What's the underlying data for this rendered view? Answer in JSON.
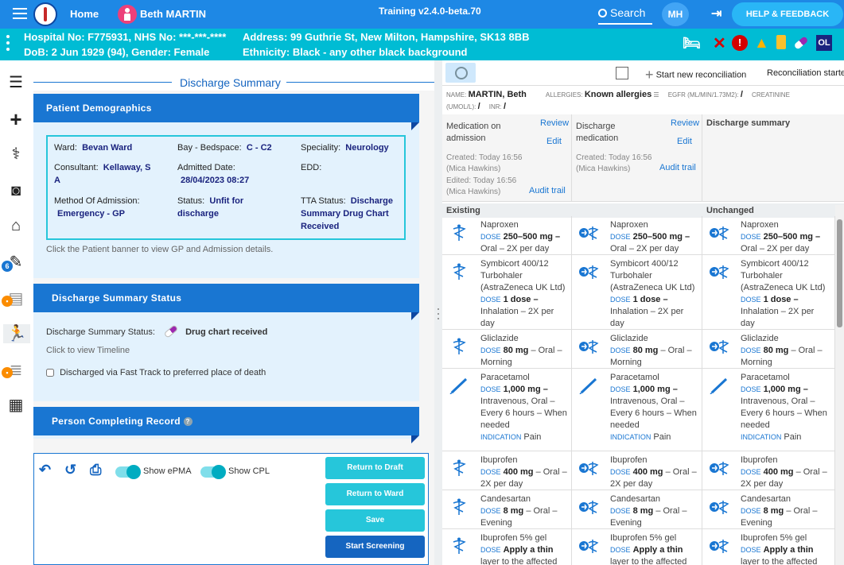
{
  "app": {
    "home_label": "Home",
    "patient_name": "Beth MARTIN",
    "version": "Training v2.4.0-beta.70",
    "search_label": "Search",
    "user_initials": "MH",
    "help_label": "HELP & FEEDBACK"
  },
  "banner": {
    "line1_left": "Hospital No: F775931, NHS No: ***-***-****",
    "line2_left": "DoB: 2 Jun 1929 (94), Gender: Female",
    "line1_right": "Address: 99 Guthrie St, New Milton, Hampshire, SK13 8BB",
    "line2_right": "Ethnicity: Black - any other black background",
    "icons": [
      "bed-icon",
      "x-icon",
      "alert-icon",
      "warning-icon",
      "bottle-icon",
      "pill-icon",
      "ol-badge"
    ],
    "ol_label": "OL"
  },
  "sidenav": {
    "badge_count": "6",
    "icons": [
      "list-icon",
      "plus-icon",
      "stethoscope-icon",
      "camera-icon",
      "house-icon",
      "edit-doc-icon",
      "clipboard-locked-icon",
      "discharge-run-icon",
      "checklist-locked-icon",
      "bed-grid-icon"
    ]
  },
  "left": {
    "title": "Discharge Summary",
    "demographics": {
      "header": "Patient Demographics",
      "ward_label": "Ward:",
      "ward_value": "Bevan Ward",
      "bay_label": "Bay - Bedspace:",
      "bay_value": "C - C2",
      "spec_label": "Speciality:",
      "spec_value": "Neurology",
      "consultant_label": "Consultant:",
      "consultant_value": "Kellaway, S",
      "consultant_value2": "A",
      "admitted_label": "Admitted Date:",
      "admitted_value": "28/04/2023 08:27",
      "edd_label": "EDD:",
      "method_label": "Method Of Admission:",
      "method_value": "Emergency - GP",
      "status_label": "Status:",
      "status_value": "Unfit for",
      "status_value2": "discharge",
      "tta_label": "TTA Status:",
      "tta_value": "Discharge",
      "tta_value2": "Summary Drug Chart",
      "tta_value3": "Received",
      "hint": "Click the Patient banner to view GP and Admission details."
    },
    "status_card": {
      "header": "Discharge Summary Status",
      "label": "Discharge Summary Status:",
      "value": "Drug chart received",
      "timeline": "Click to view Timeline",
      "fasttrack": "Discharged via Fast Track to preferred place of death"
    },
    "person_header": "Person Completing Record",
    "toolbar": {
      "show_epma": "Show ePMA",
      "show_cpl": "Show CPL",
      "return_draft": "Return to Draft",
      "return_ward": "Return to Ward",
      "save": "Save",
      "start_screening": "Start Screening"
    }
  },
  "right": {
    "top": {
      "start_new": "Start new reconciliation",
      "recon_started": "Reconciliation started"
    },
    "meta": {
      "name_label": "NAME:",
      "name_value": "MARTIN, Beth",
      "allergies_label": "ALLERGIES:",
      "allergies_value": "Known allergies",
      "egfr_label": "EGFR (ML/MIN/1.73M2):",
      "egfr_value": "/",
      "creat_label": "CREATININE",
      "creat_unit": "(UMOL/L):",
      "creat_value": "/",
      "inr_label": "INR:",
      "inr_value": "/"
    },
    "cols": {
      "c1_title": "Medication on admission",
      "c1_review": "Review",
      "c1_edit": "Edit",
      "c1_created": "Created: Today 16:56",
      "c1_created_by": "(Mica Hawkins)",
      "c1_edited": "Edited: Today 16:56",
      "c1_edited_by": "(Mica Hawkins)",
      "c1_audit": "Audit trail",
      "c2_title": "Discharge medication",
      "c2_review": "Review",
      "c2_edit": "Edit",
      "c2_created": "Created: Today 16:56",
      "c2_created_by": "(Mica Hawkins)",
      "c2_audit": "Audit trail",
      "c3_title": "Discharge summary"
    },
    "groups": {
      "existing": "Existing",
      "unchanged": "Unchanged"
    },
    "dose_label": "DOSE",
    "indication_label": "INDICATION",
    "meds": [
      {
        "name": [
          "Naproxen"
        ],
        "dose": "250–500 mg –",
        "route": [
          "Oral – 2X per day"
        ],
        "indication": ""
      },
      {
        "name": [
          "Symbicort 400/12",
          "Turbohaler",
          "(AstraZeneca UK Ltd)"
        ],
        "dose": "1 dose –",
        "route": [
          "Inhalation – 2X per",
          "day"
        ],
        "indication": ""
      },
      {
        "name": [
          "Gliclazide"
        ],
        "dose": "80 mg",
        "route_inline": "– Oral –",
        "route": [
          "Morning"
        ],
        "indication": ""
      },
      {
        "name": [
          "Paracetamol"
        ],
        "dose": "1,000 mg –",
        "route": [
          "Intravenous, Oral –",
          "Every 6 hours – When",
          "needed"
        ],
        "indication": "Pain"
      },
      {
        "name": [
          "Ibuprofen"
        ],
        "dose": "400 mg",
        "route_inline": "– Oral –",
        "route": [
          "2X per day"
        ],
        "indication": ""
      },
      {
        "name": [
          "Candesartan"
        ],
        "dose": "8 mg",
        "route_inline": "– Oral –",
        "route": [
          "Evening"
        ],
        "indication": ""
      },
      {
        "name": [
          "Ibuprofen 5% gel"
        ],
        "dose": "Apply a thin",
        "route": [
          "layer to the affected"
        ],
        "indication": ""
      }
    ]
  }
}
